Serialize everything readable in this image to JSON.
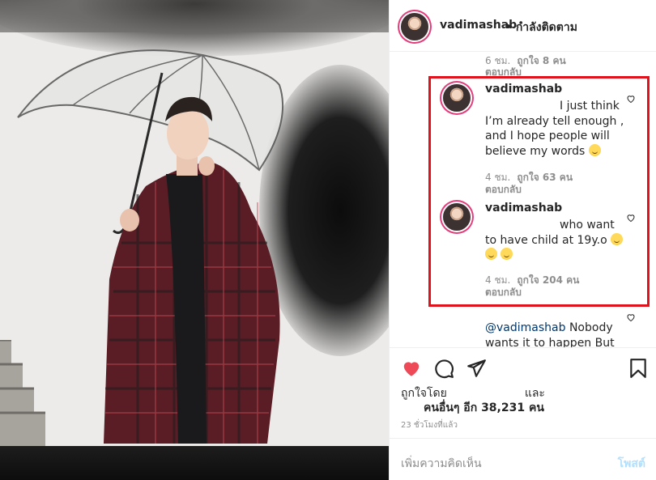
{
  "photo": {
    "description_icon": "post-photo"
  },
  "header": {
    "username": "vadimashab",
    "follow_status": "• กำลังติดตาม"
  },
  "previous_comment": {
    "time": "6 ชม.",
    "likes": "ถูกใจ 8 คน",
    "reply": "ตอบกลับ"
  },
  "highlighted_comments": [
    {
      "username": "vadimashab",
      "lines": [
        "I just think",
        "I’m already tell enough ,",
        "and I hope people will",
        "believe my words"
      ],
      "emoji": "😑",
      "time": "4 ชม.",
      "likes": "ถูกใจ 63 คน",
      "reply": "ตอบกลับ"
    },
    {
      "username": "vadimashab",
      "lines": [
        "who want",
        "to have child at 19y.o"
      ],
      "emoji": "😅😅😅",
      "time": "4 ชม.",
      "likes": "ถูกใจ 204 คน",
      "reply": "ตอบกลับ"
    }
  ],
  "partial_comment": {
    "mention": "@vadimashab",
    "text_line1": " Nobody",
    "text_line2": "wants it to happen But"
  },
  "actions": {
    "like_icon": "heart-filled-icon",
    "comment_icon": "comment-icon",
    "share_icon": "share-icon",
    "save_icon": "bookmark-icon"
  },
  "likes": {
    "liked_by": "ถูกใจโดย",
    "and": "และ",
    "others": "คนอื่นๆ อีก 38,231 คน"
  },
  "timestamp": "23 ชั่วโมงที่แล้ว",
  "composer": {
    "placeholder": "เพิ่มความคิดเห็น",
    "post_label": "โพสต์"
  },
  "colors": {
    "highlight": "#e0121c",
    "like": "#ed4956",
    "link": "#00376b",
    "post_disabled": "#b2dffc"
  }
}
